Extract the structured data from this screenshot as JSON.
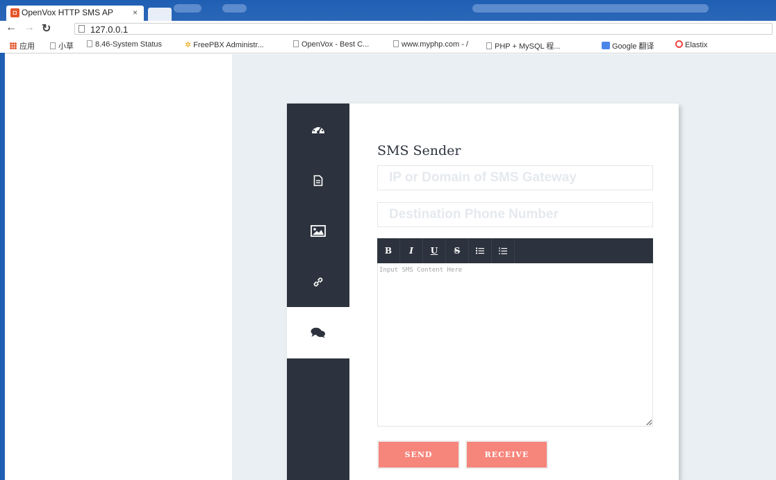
{
  "browser": {
    "tab_title": "OpenVox HTTP SMS AP",
    "tab_close": "×",
    "url": "127.0.0.1",
    "bookmarks": [
      {
        "label": "应用",
        "icon": "apps-icon"
      },
      {
        "label": "小草",
        "icon": "page-icon"
      },
      {
        "label": "8.46-System Status",
        "icon": "page-icon"
      },
      {
        "label": "FreePBX Administr...",
        "icon": "freepbx-icon"
      },
      {
        "label": "OpenVox - Best C...",
        "icon": "page-icon"
      },
      {
        "label": "www.myphp.com - /",
        "icon": "page-icon"
      },
      {
        "label": "PHP + MySQL 程...",
        "icon": "page-icon"
      },
      {
        "label": "Google 翻译",
        "icon": "google-translate-icon"
      },
      {
        "label": "Elastix",
        "icon": "elastix-icon"
      }
    ]
  },
  "sidebar": {
    "items": [
      {
        "icon": "dashboard-icon",
        "active": false
      },
      {
        "icon": "document-icon",
        "active": false
      },
      {
        "icon": "image-icon",
        "active": false
      },
      {
        "icon": "link-icon",
        "active": false
      },
      {
        "icon": "comments-icon",
        "active": true
      }
    ]
  },
  "form": {
    "title": "SMS Sender",
    "gateway_placeholder": "IP or Domain of SMS Gateway",
    "phone_placeholder": "Destination Phone Number",
    "content_placeholder": "Input SMS Content Here",
    "toolbar": [
      {
        "name": "bold",
        "label": "B"
      },
      {
        "name": "italic",
        "label": "I"
      },
      {
        "name": "underline",
        "label": "U"
      },
      {
        "name": "strikethrough",
        "label": "S"
      },
      {
        "name": "unordered-list",
        "label": ""
      },
      {
        "name": "ordered-list",
        "label": ""
      }
    ],
    "send_label": "SEND",
    "receive_label": "RECEIVE"
  },
  "colors": {
    "sidebar_bg": "#2d333e",
    "page_bg": "#e9eff2",
    "button_bg": "#f6857b",
    "chrome_blue": "#1f5fb3"
  }
}
